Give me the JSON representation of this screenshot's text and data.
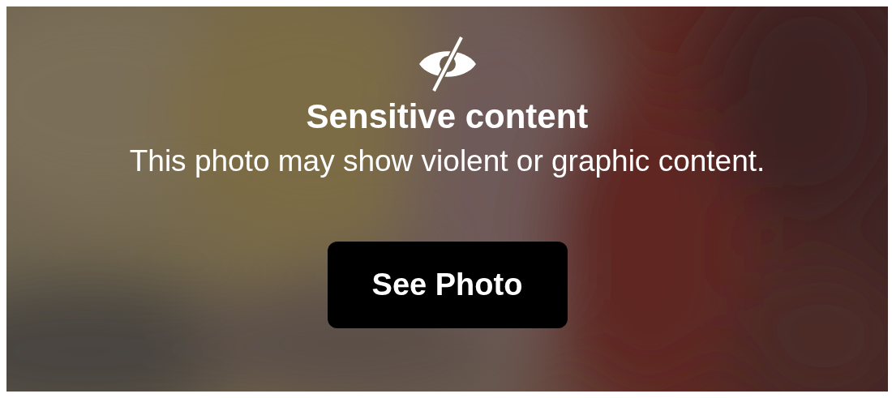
{
  "notice": {
    "title": "Sensitive content",
    "message": "This photo may show violent or graphic content."
  },
  "button": {
    "label": "See Photo"
  }
}
